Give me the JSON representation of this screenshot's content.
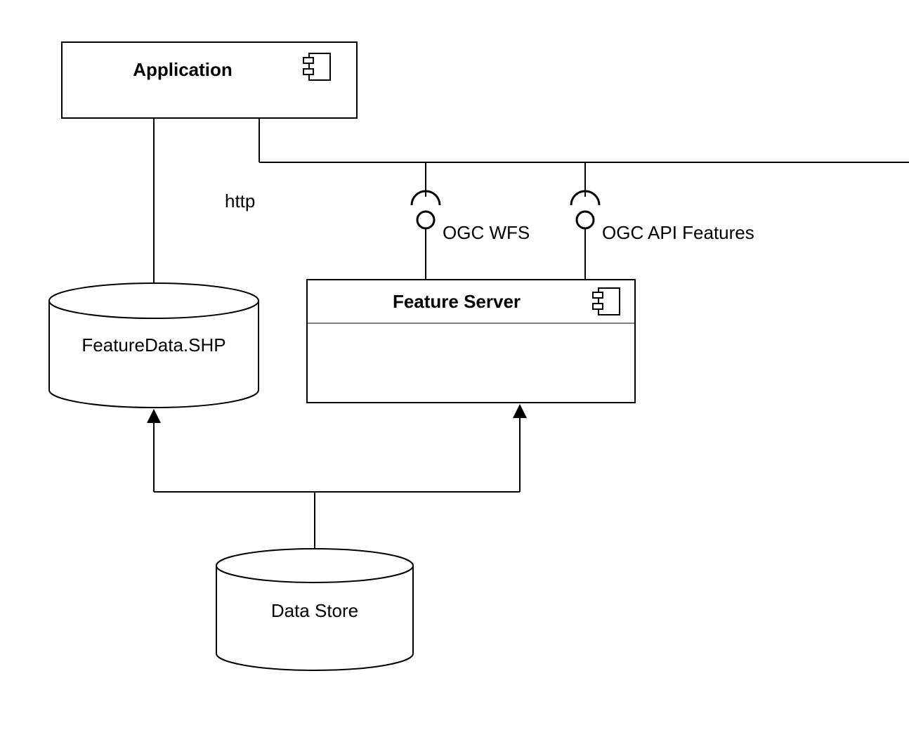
{
  "application": {
    "label": "Application"
  },
  "featureDataShp": {
    "label": "FeatureData.SHP"
  },
  "httpLabel": "http",
  "ogcWfsLabel": "OGC WFS",
  "ogcApiFeaturesLabel": "OGC API Features",
  "featureServer": {
    "label": "Feature Server"
  },
  "dataStore": {
    "label": "Data Store"
  }
}
